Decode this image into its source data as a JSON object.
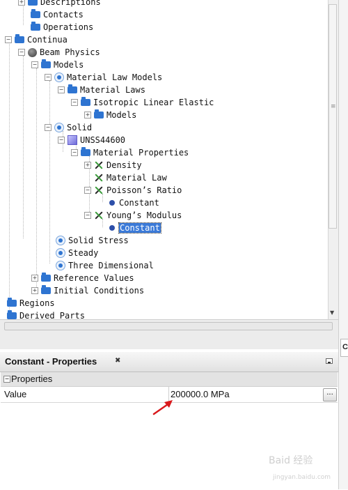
{
  "tree": {
    "items": [
      {
        "label": "Descriptions",
        "icon": "folder-icon"
      },
      {
        "label": "Contacts",
        "icon": "folder-icon"
      },
      {
        "label": "Operations",
        "icon": "folder-icon"
      },
      {
        "label": "Continua",
        "icon": "folder-icon"
      },
      {
        "label": "Beam Physics",
        "icon": "physics-sphere-icon"
      },
      {
        "label": "Models",
        "icon": "folder-icon"
      },
      {
        "label": "Material Law Models",
        "icon": "radio-model-icon"
      },
      {
        "label": "Material Laws",
        "icon": "folder-icon"
      },
      {
        "label": "Isotropic Linear Elastic",
        "icon": "folder-icon"
      },
      {
        "label": "Models",
        "icon": "folder-icon"
      },
      {
        "label": "Solid",
        "icon": "radio-model-icon"
      },
      {
        "label": "UNSS44600",
        "icon": "cube-icon"
      },
      {
        "label": "Material Properties",
        "icon": "folder-icon"
      },
      {
        "label": "Density",
        "icon": "property-icon"
      },
      {
        "label": "Material Law",
        "icon": "property-icon"
      },
      {
        "label": "Poisson’s Ratio",
        "icon": "property-icon"
      },
      {
        "label": "Constant",
        "icon": "dot-icon"
      },
      {
        "label": "Young’s Modulus",
        "icon": "property-icon"
      },
      {
        "label": "Constant",
        "icon": "dot-icon"
      },
      {
        "label": "Solid Stress",
        "icon": "radio-model-icon"
      },
      {
        "label": "Steady",
        "icon": "radio-model-icon"
      },
      {
        "label": "Three Dimensional",
        "icon": "radio-model-icon"
      },
      {
        "label": "Reference Values",
        "icon": "folder-icon"
      },
      {
        "label": "Initial Conditions",
        "icon": "folder-icon"
      },
      {
        "label": "Regions",
        "icon": "folder-icon"
      },
      {
        "label": "Derived Parts",
        "icon": "folder-icon"
      }
    ],
    "selected_label": "Constant"
  },
  "properties": {
    "title": "Constant - Properties",
    "close_glyph": "✖",
    "section_label": "Properties",
    "section_toggle": "−",
    "rows": [
      {
        "name": "Value",
        "value": "200000.0 MPa",
        "button_label": "..."
      }
    ]
  },
  "side_tab_label": "C",
  "watermark": {
    "text": "Baid 经验",
    "sub": "jingyan.baidu.com"
  },
  "colors": {
    "accent": "#3b7ad8",
    "folder": "#2e74d1",
    "annotation_arrow": "#d9191c"
  }
}
